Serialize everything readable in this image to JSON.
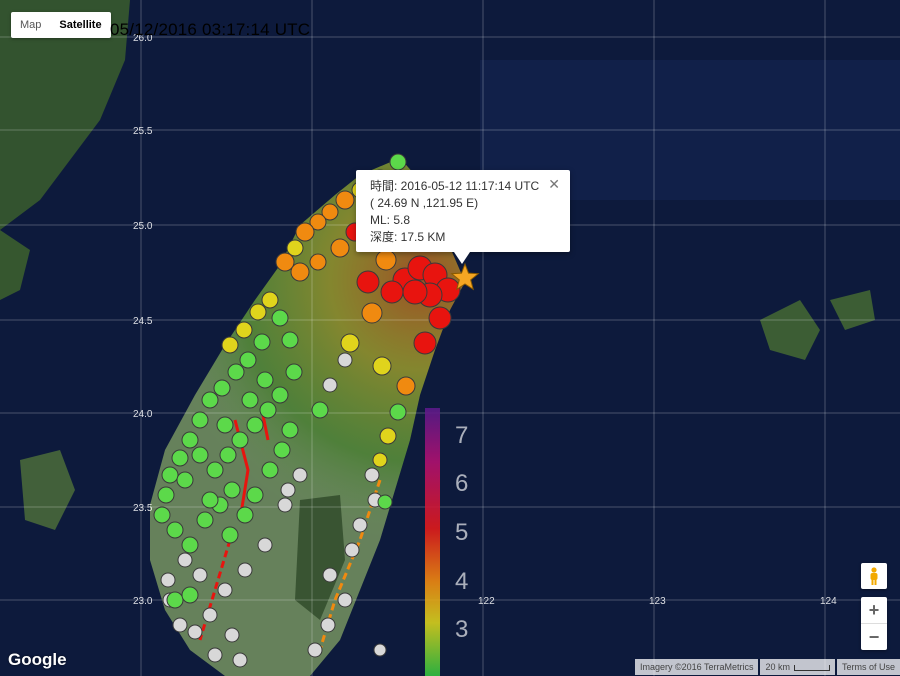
{
  "map_type_control": {
    "map_label": "Map",
    "satellite_label": "Satellite",
    "selected": "Satellite"
  },
  "timestamp": "05/12/2016 03:17:14 UTC",
  "grid_labels": {
    "latitude": [
      "26.0",
      "25.5",
      "25.0",
      "24.5",
      "24.0",
      "23.5",
      "23.0"
    ],
    "longitude": [
      "122",
      "123",
      "124"
    ]
  },
  "info_window": {
    "time": "時間: 2016-05-12 11:17:14 UTC",
    "coords": "( 24.69 N ,121.95 E)",
    "ml": "ML: 5.8",
    "depth": "深度: 17.5 KM",
    "close_label": "✕"
  },
  "epicenter": {
    "lat": 24.69,
    "lon": 121.95,
    "marker_color": "#f5a623"
  },
  "intensity_scale": {
    "labels": [
      "7",
      "6",
      "5",
      "4",
      "3"
    ]
  },
  "zoom_control": {
    "in_label": "+",
    "out_label": "−"
  },
  "attribution": {
    "google_logo": "Google",
    "imagery": "Imagery ©2016 TerraMetrics",
    "scale": "20 km",
    "terms": "Terms of Use"
  },
  "colors": {
    "ocean": "#0d1a3c",
    "land": "#4b6b3e",
    "station_red": "#e8140f",
    "station_orange": "#f08a10",
    "station_yellow": "#e0d41c",
    "station_green": "#5cd94a",
    "station_gray": "#d8d8d8"
  }
}
